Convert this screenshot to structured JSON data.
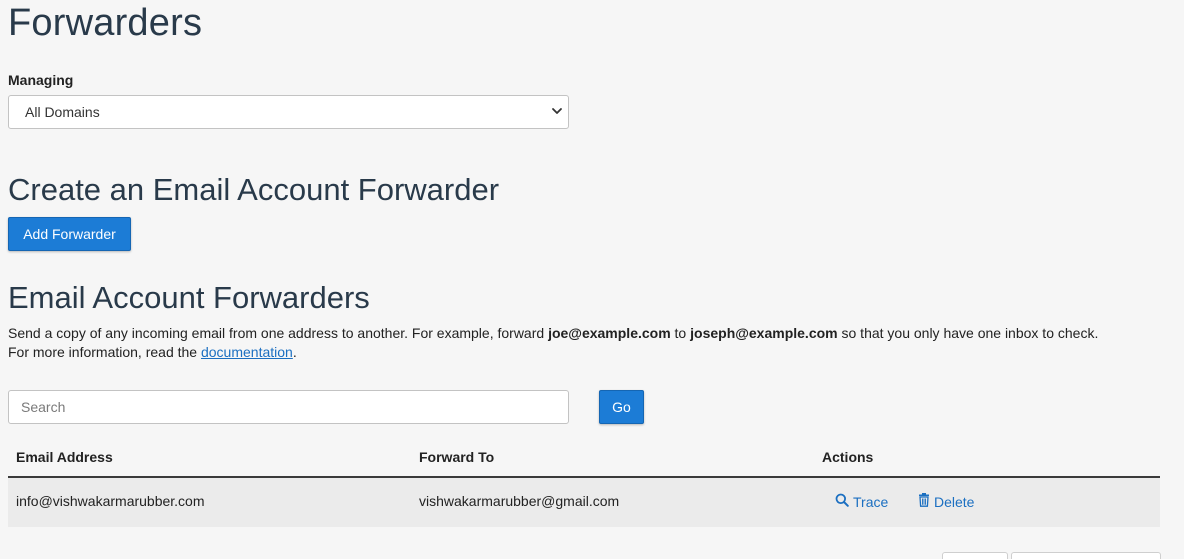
{
  "page": {
    "title": "Forwarders"
  },
  "managing": {
    "label": "Managing",
    "selected": "All Domains"
  },
  "create_section": {
    "title": "Create an Email Account Forwarder",
    "add_button": "Add Forwarder"
  },
  "list_section": {
    "title": "Email Account Forwarders",
    "description_before": "Send a copy of any incoming email from one address to another. For example, forward ",
    "example_from": "joe@example.com",
    "description_mid": " to ",
    "example_to": "joseph@example.com",
    "description_after": " so that you only have one inbox to check.",
    "more_info_prefix": "For more information, read the ",
    "doc_link": "documentation",
    "more_info_suffix": "."
  },
  "search": {
    "placeholder": "Search",
    "value": "",
    "go_label": "Go"
  },
  "table": {
    "columns": [
      "Email Address",
      "Forward To",
      "Actions"
    ],
    "rows": [
      {
        "email": "info@vishwakarmarubber.com",
        "forward_to": "vishwakarmarubber@gmail.com",
        "trace_label": "Trace",
        "delete_label": "Delete"
      }
    ]
  },
  "colors": {
    "primary": "#1c7cd6",
    "link": "#1b6fc1",
    "background": "#f6f6f6",
    "row_bg": "#ebebeb"
  },
  "icons": {
    "select_arrow": "chevron-down-icon",
    "trace": "search-icon",
    "delete": "trash-icon"
  }
}
